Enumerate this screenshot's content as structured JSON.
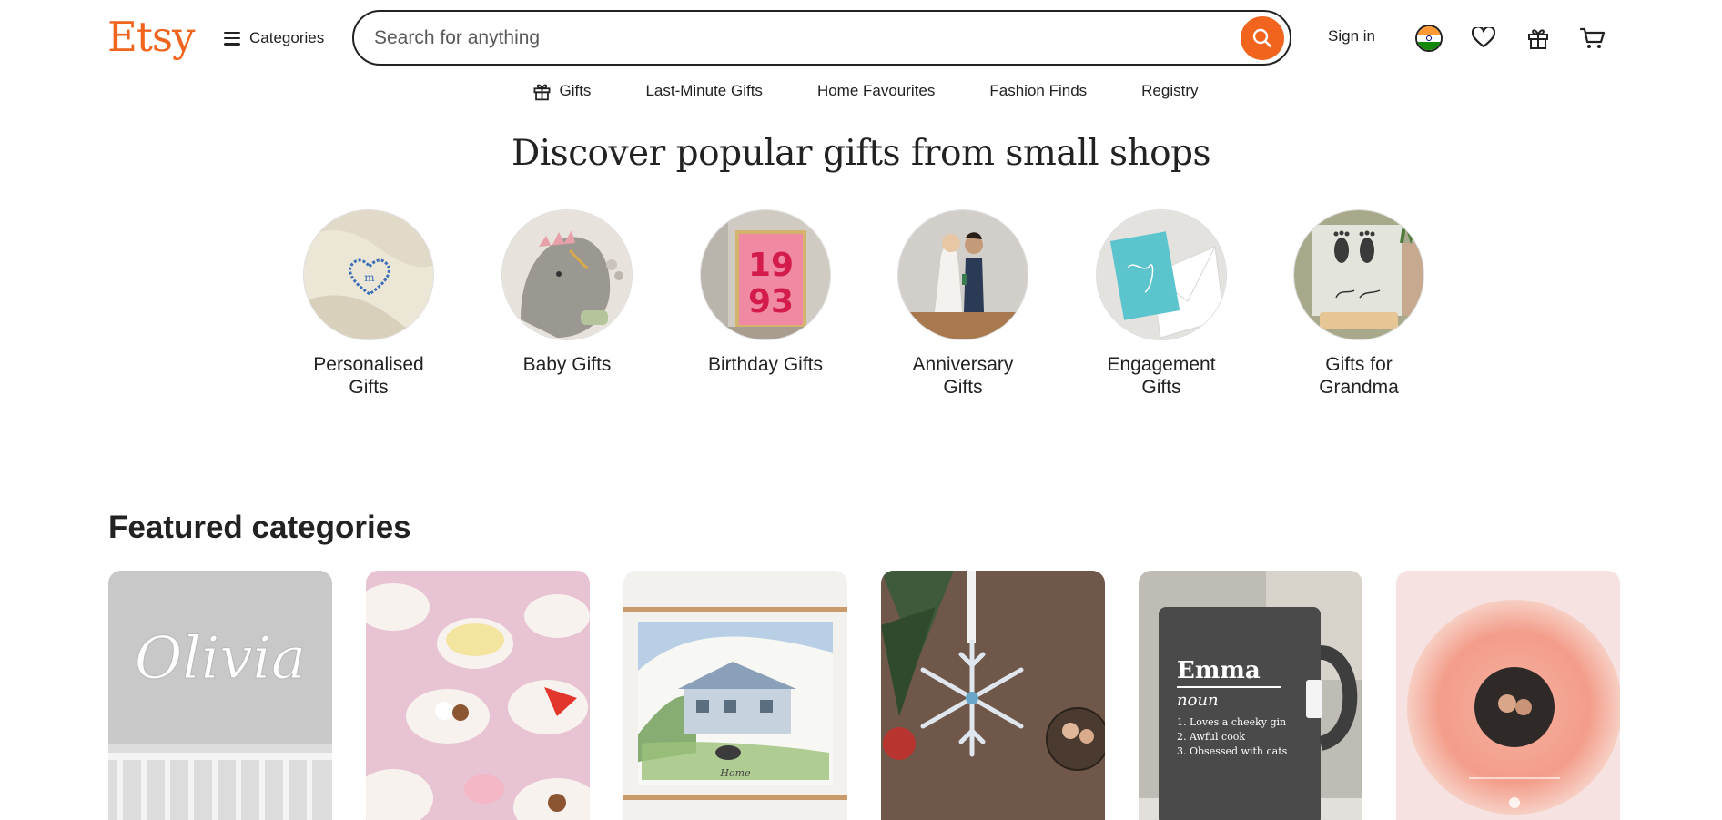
{
  "header": {
    "logo": "Etsy",
    "categories_label": "Categories",
    "search_placeholder": "Search for anything",
    "signin_label": "Sign in"
  },
  "subnav": {
    "items": [
      {
        "label": "Gifts",
        "icon": "gift-icon"
      },
      {
        "label": "Last-Minute Gifts"
      },
      {
        "label": "Home Favourites"
      },
      {
        "label": "Fashion Finds"
      },
      {
        "label": "Registry"
      }
    ]
  },
  "discover": {
    "title": "Discover popular gifts from small shops",
    "items": [
      {
        "label": "Personalised Gifts"
      },
      {
        "label": "Baby Gifts"
      },
      {
        "label": "Birthday Gifts"
      },
      {
        "label": "Anniversary Gifts"
      },
      {
        "label": "Engagement Gifts"
      },
      {
        "label": "Gifts for Grandma"
      }
    ]
  },
  "featured": {
    "title": "Featured categories",
    "cards": [
      {
        "image_text": "Olivia"
      },
      {
        "image_text": ""
      },
      {
        "image_text": "Home"
      },
      {
        "image_text": ""
      },
      {
        "image_text": "Emma",
        "sub": "noun",
        "lines": [
          "1. Loves a cheeky gin",
          "2. Awful cook",
          "3. Obsessed with cats"
        ]
      },
      {
        "image_text": ""
      }
    ]
  },
  "colors": {
    "brand": "#f1641e",
    "text": "#222222",
    "border": "#d0d0d0"
  }
}
